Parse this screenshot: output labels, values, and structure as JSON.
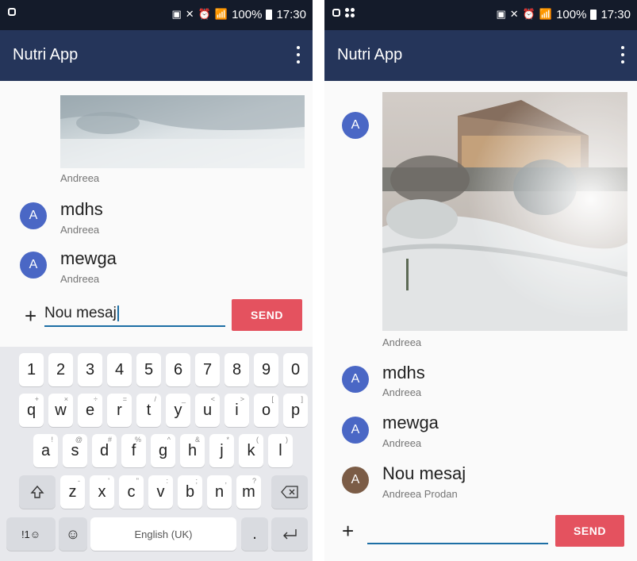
{
  "status": {
    "battery": "100%",
    "time": "17:30"
  },
  "app": {
    "title": "Nutri App"
  },
  "left": {
    "photo_author": "Andreea",
    "messages": [
      {
        "avatar": "A",
        "text": "mdhs",
        "author": "Andreea"
      },
      {
        "avatar": "A",
        "text": "mewga",
        "author": "Andreea"
      }
    ],
    "composer": {
      "plus": "+",
      "value": "Nou mesaj",
      "send": "SEND"
    }
  },
  "keyboard": {
    "numbers": [
      "1",
      "2",
      "3",
      "4",
      "5",
      "6",
      "7",
      "8",
      "9",
      "0"
    ],
    "row1": [
      "q",
      "w",
      "e",
      "r",
      "t",
      "y",
      "u",
      "i",
      "o",
      "p"
    ],
    "row1_hints": [
      "+",
      "×",
      "÷",
      "=",
      "/",
      "_",
      "<",
      ">",
      "[",
      "]"
    ],
    "row2": [
      "a",
      "s",
      "d",
      "f",
      "g",
      "h",
      "j",
      "k",
      "l"
    ],
    "row2_hints": [
      "!",
      "@",
      "#",
      "%",
      "^",
      "&",
      "*",
      "(",
      ")"
    ],
    "row3": [
      "z",
      "x",
      "c",
      "v",
      "b",
      "n",
      "m"
    ],
    "row3_hints": [
      "-",
      "'",
      "\"",
      ":",
      ";",
      ",",
      "?"
    ],
    "symbols_label": "!1☺",
    "space_label": "English (UK)",
    "period": "."
  },
  "right": {
    "avatar": "A",
    "photo_author": "Andreea",
    "messages": [
      {
        "avatar": "A",
        "text": "mdhs",
        "author": "Andreea",
        "avatar_color": "#4a67c5"
      },
      {
        "avatar": "A",
        "text": "mewga",
        "author": "Andreea",
        "avatar_color": "#4a67c5"
      },
      {
        "avatar": "A",
        "text": "Nou mesaj",
        "author": "Andreea Prodan",
        "avatar_color": "#7b5c46"
      }
    ],
    "composer": {
      "plus": "+",
      "value": "",
      "send": "SEND"
    }
  },
  "colors": {
    "appbar": "#25355a",
    "statusbar": "#141b2a",
    "send": "#e4525f",
    "avatar": "#4a67c5",
    "input_line": "#1d6fa5"
  }
}
